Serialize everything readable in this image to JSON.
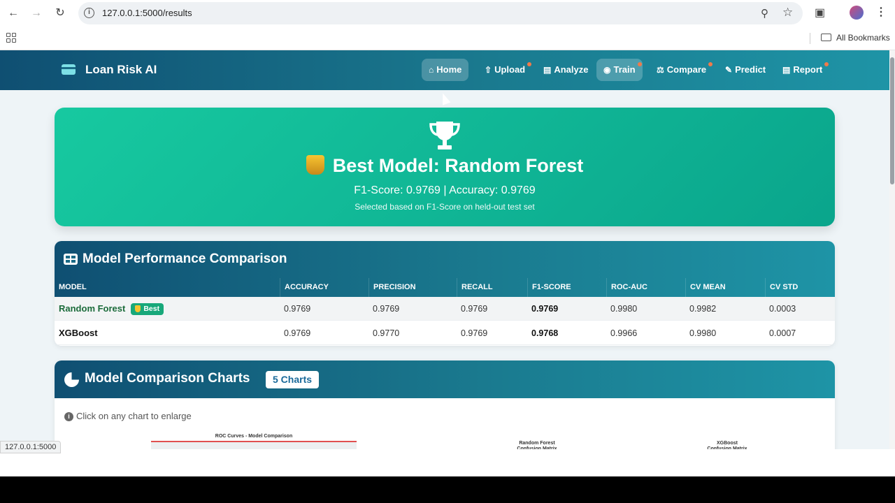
{
  "browser": {
    "url": "127.0.0.1:5000/results",
    "bookmarks_label": "All Bookmarks",
    "status_url": "127.0.0.1:5000"
  },
  "nav": {
    "brand": "Loan Risk AI",
    "items": [
      {
        "label": "Home",
        "icon": "home-icon",
        "active": true,
        "dot": false
      },
      {
        "label": "Upload",
        "icon": "upload-icon",
        "active": false,
        "dot": true
      },
      {
        "label": "Analyze",
        "icon": "chart-icon",
        "active": false,
        "dot": false
      },
      {
        "label": "Train",
        "icon": "robot-icon",
        "active": true,
        "dot": true
      },
      {
        "label": "Compare",
        "icon": "scale-icon",
        "active": false,
        "dot": true
      },
      {
        "label": "Predict",
        "icon": "pencil-icon",
        "active": false,
        "dot": false
      },
      {
        "label": "Report",
        "icon": "file-icon",
        "active": false,
        "dot": true
      }
    ]
  },
  "hero": {
    "title": "Best Model: Random Forest",
    "metrics": "F1-Score: 0.9769 | Accuracy: 0.9769",
    "note": "Selected based on F1-Score on held-out test set"
  },
  "performance": {
    "title": "Model Performance Comparison",
    "columns": [
      "MODEL",
      "ACCURACY",
      "PRECISION",
      "RECALL",
      "F1-SCORE",
      "ROC-AUC",
      "CV MEAN",
      "CV STD"
    ],
    "best_label": "Best",
    "rows": [
      {
        "model": "Random Forest",
        "accuracy": "0.9769",
        "precision": "0.9769",
        "recall": "0.9769",
        "f1": "0.9769",
        "roc_auc": "0.9980",
        "cv_mean": "0.9982",
        "cv_std": "0.0003"
      },
      {
        "model": "XGBoost",
        "accuracy": "0.9769",
        "precision": "0.9770",
        "recall": "0.9769",
        "f1": "0.9768",
        "roc_auc": "0.9966",
        "cv_mean": "0.9980",
        "cv_std": "0.0007"
      }
    ]
  },
  "charts": {
    "title": "Model Comparison Charts",
    "badge": "5 Charts",
    "hint": "Click on any chart to enlarge",
    "thumbs": [
      {
        "title": "ROC Curves - Model Comparison"
      },
      {
        "title": "Random Forest\nConfusion Matrix"
      },
      {
        "title": "XGBoost\nConfusion Matrix"
      }
    ]
  },
  "colors": {
    "header": "#0f4f72",
    "accent": "#1e94a6",
    "hero": "#17c9a0",
    "best_badge": "#18a87a",
    "dot": "#f07a4a"
  }
}
